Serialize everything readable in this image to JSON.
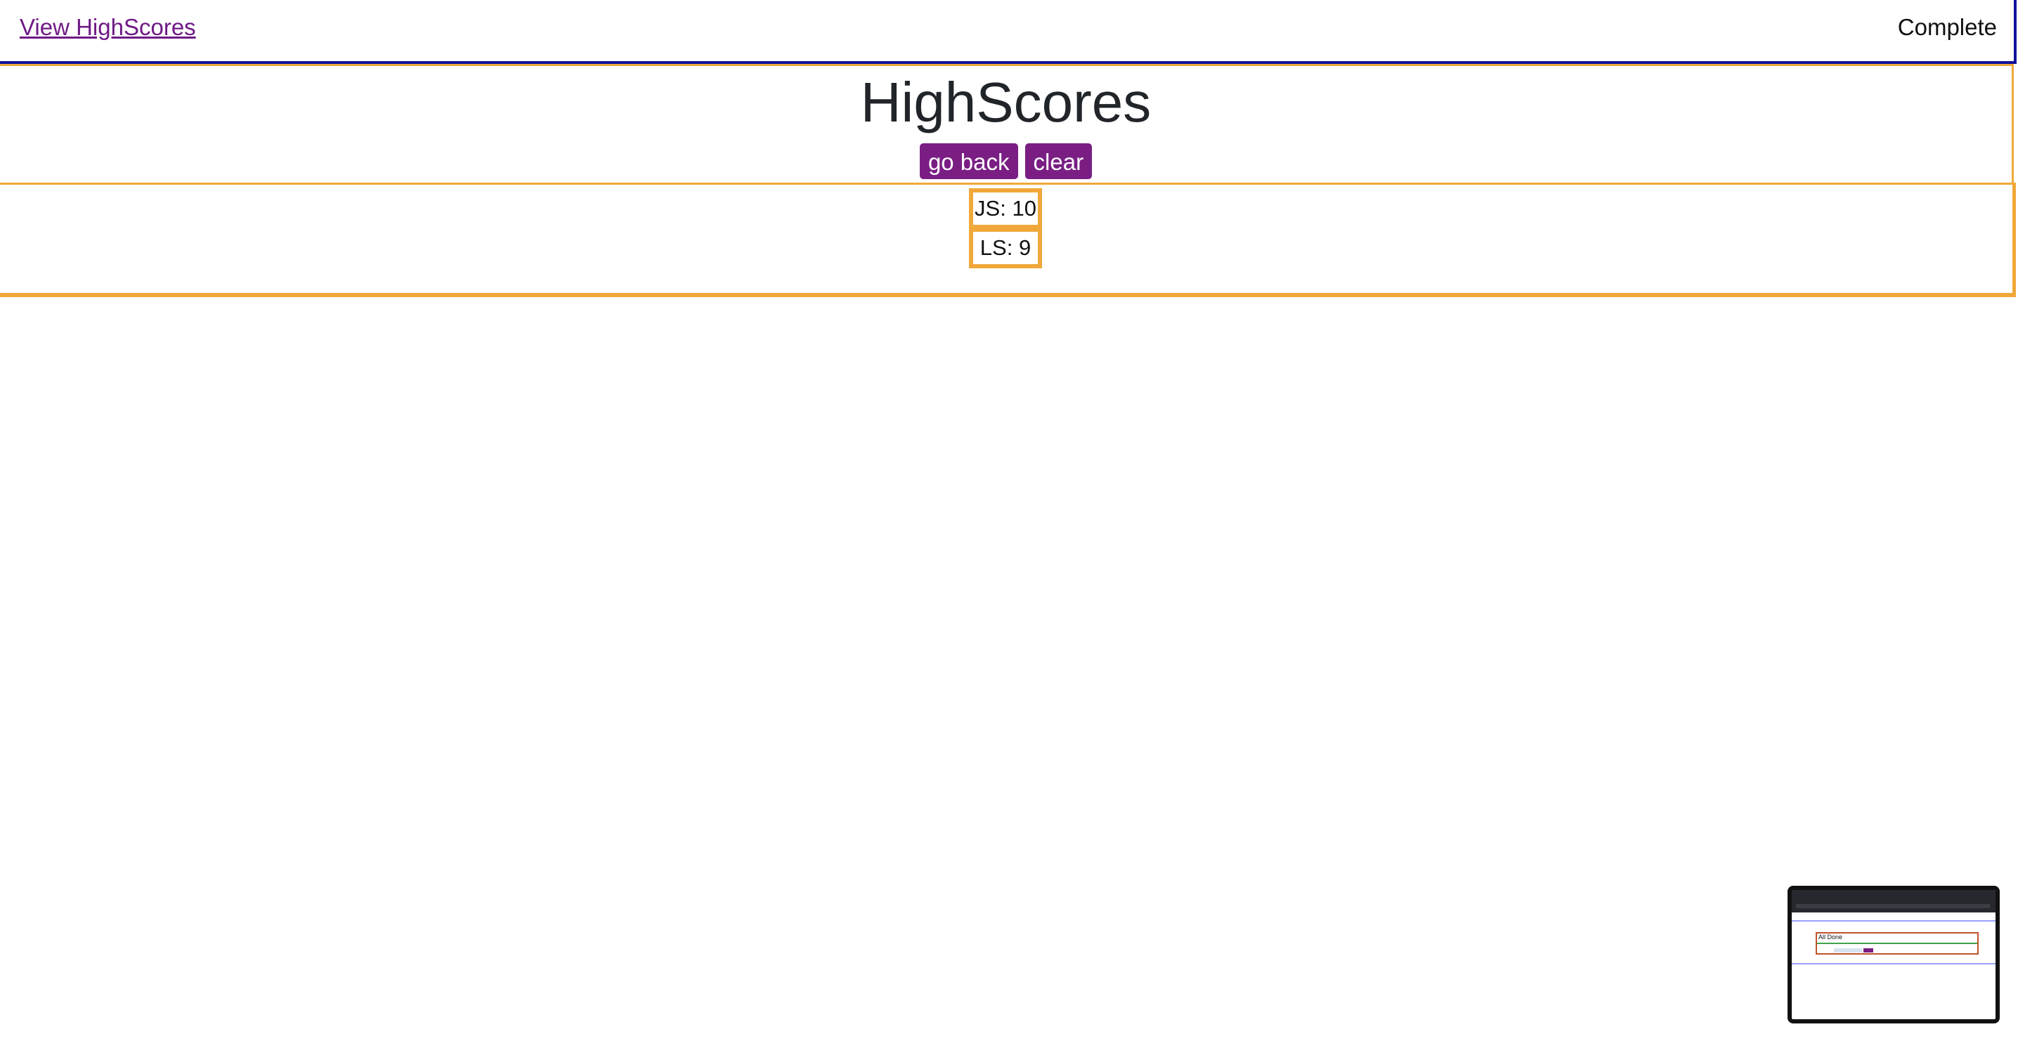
{
  "header": {
    "view_link": "View HighScores",
    "status": "Complete"
  },
  "highscores": {
    "title": "HighScores",
    "go_back_label": "go back",
    "clear_label": "clear"
  },
  "scores": [
    {
      "text": "JS: 10"
    },
    {
      "text": "LS: 9"
    }
  ],
  "thumbnail": {
    "title": "All Done"
  },
  "colors": {
    "accent_purple": "#7a1e84",
    "border_orange": "#f0a83a",
    "header_border_blue": "#12129a"
  }
}
